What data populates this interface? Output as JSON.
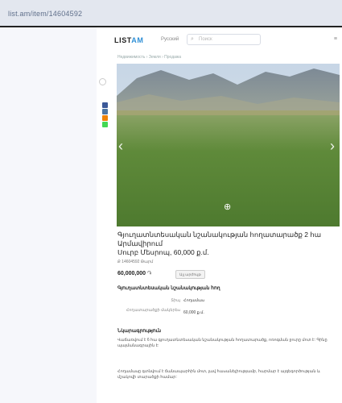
{
  "browser": {
    "url": "list.am/item/14604592"
  },
  "header": {
    "logo_main": "LIST",
    "logo_accent": "AM",
    "language": "Русский",
    "search_placeholder": "Поиск",
    "right_glyph": "≡"
  },
  "breadcrumb": "Недвижимость › Земля › Продажа",
  "icons": {
    "favorite": "heart-icon",
    "prev": "chevron-left-icon",
    "next": "chevron-right-icon",
    "zoom": "zoom-icon",
    "share": [
      "facebook-share-icon",
      "vk-share-icon",
      "ok-share-icon",
      "whatsapp-share-icon"
    ]
  },
  "colors": {
    "share": [
      "#3b5998",
      "#4c75a3",
      "#ee8208",
      "#43d854"
    ],
    "accent": "#2f8fd6"
  },
  "listing": {
    "title": "Գյուղատնտեսական նշանակության հողատարածք 2 հա Արմավիրում",
    "subtitle": "Սուրբ Մեսրոպ, 60,000 ք.մ.",
    "meta": "Ք 14604592 Թարմ",
    "price": "60,000,000",
    "currency": "֏",
    "price_button": "Այլ արժույթ"
  },
  "details": {
    "heading": "Գյուղատնտեսական նշանակության հող",
    "rows": [
      {
        "label": "Տիպ",
        "value": "Հողամաս"
      },
      {
        "label": "Հողատարածքի մակերես",
        "value": "60,000 ք.մ."
      }
    ]
  },
  "description": {
    "heading": "Նկարագրություն",
    "paragraph1": "Վաճառվում է 6 հա գյուղատնտեսական նշանակության հողատարածք, ոռոգման ջուրը մոտ է: Գինը պայմանագրային է:",
    "paragraph2": "Հողամասը գտնվում է ճանապարհին մոտ, լավ հասանելիությամբ, հարմար է այգեգործության և մշակովի տարածքի համար:"
  }
}
